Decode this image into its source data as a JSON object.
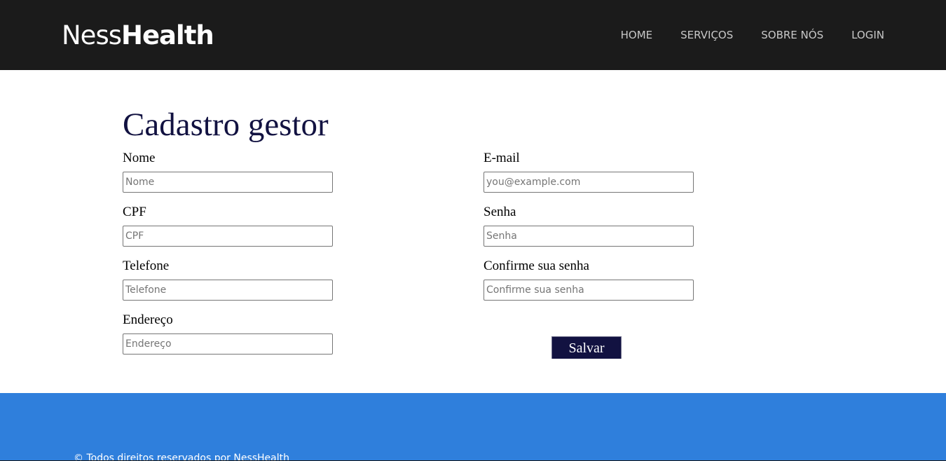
{
  "header": {
    "brand_regular": "Ness",
    "brand_bold": "Health",
    "nav": {
      "home": "HOME",
      "services": "SERVIÇOS",
      "about": "SOBRE NÓS",
      "login": "LOGIN"
    }
  },
  "form": {
    "title": "Cadastro gestor",
    "fields": {
      "nome": {
        "label": "Nome",
        "placeholder": "Nome",
        "value": ""
      },
      "cpf": {
        "label": "CPF",
        "placeholder": "CPF",
        "value": ""
      },
      "telefone": {
        "label": "Telefone",
        "placeholder": "Telefone",
        "value": ""
      },
      "endereco": {
        "label": "Endereço",
        "placeholder": "Endereço",
        "value": ""
      },
      "email": {
        "label": "E-mail",
        "placeholder": "you@example.com",
        "value": ""
      },
      "senha": {
        "label": "Senha",
        "placeholder": "Senha",
        "value": ""
      },
      "confirme": {
        "label": "Confirme sua senha",
        "placeholder": "Confirme sua senha",
        "value": ""
      }
    },
    "submit_label": "Salvar"
  },
  "footer": {
    "copyright": "© Todos direitos reservados por NessHealth"
  },
  "colors": {
    "navbar_bg": "#1b1b1b",
    "title": "#121241",
    "button_bg": "#121241",
    "footer_bg": "#2f7fdc"
  }
}
